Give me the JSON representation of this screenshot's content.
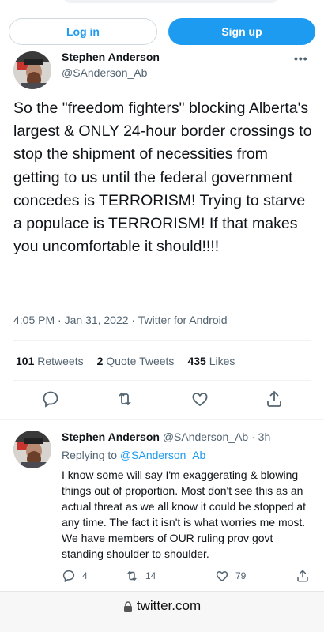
{
  "auth": {
    "login_label": "Log in",
    "signup_label": "Sign up"
  },
  "tweet": {
    "author_name": "Stephen Anderson",
    "author_handle": "@SAnderson_Ab",
    "more_label": "•••",
    "text": "So the \"freedom fighters\" blocking Alberta's largest & ONLY 24-hour border crossings to stop the shipment of necessities from getting to us until the federal government concedes is TERRORISM! Trying to starve a populace is TERRORISM! If that makes you uncomfortable it should!!!!",
    "timestamp": "4:05 PM · Jan 31, 2022 · Twitter for Android",
    "stats": {
      "retweets_count": "101",
      "retweets_label": "Retweets",
      "quotes_count": "2",
      "quotes_label": "Quote Tweets",
      "likes_count": "435",
      "likes_label": "Likes"
    },
    "actions": [
      "reply-icon",
      "retweet-icon",
      "like-icon",
      "share-icon"
    ]
  },
  "reply": {
    "author_name": "Stephen Anderson",
    "author_handle": "@SAnderson_Ab",
    "age": "· 3h",
    "replying_prefix": "Replying to",
    "replying_to": "@SAnderson_Ab",
    "text": "I know some will say I'm exaggerating & blowing things out of proportion. Most don't see this as an actual threat as we all know it could be stopped at any time. The fact it isn't is what worries me most. We have members of OUR ruling prov govt standing shoulder to shoulder.",
    "reply_count": "4",
    "retweet_count": "14",
    "like_count": "79"
  },
  "browser": {
    "url": "twitter.com",
    "lock_icon": "lock-icon"
  },
  "colors": {
    "accent": "#1d9bf0",
    "text": "#0f1419",
    "muted": "#536471"
  }
}
